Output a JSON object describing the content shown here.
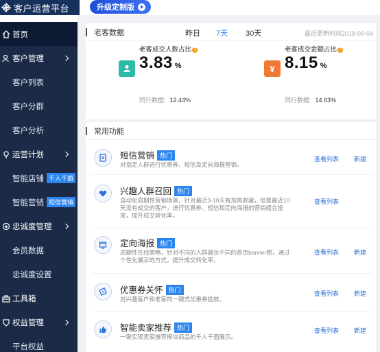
{
  "app": {
    "title": "客户运营平台",
    "upgrade_label": "升级定制版"
  },
  "sidebar": {
    "items": [
      {
        "label": "首页",
        "type": "parent",
        "icon": "home-icon",
        "active": true
      },
      {
        "label": "客户管理",
        "type": "parent",
        "icon": "users-icon"
      },
      {
        "label": "客户列表",
        "type": "child"
      },
      {
        "label": "客户分群",
        "type": "child"
      },
      {
        "label": "客户分析",
        "type": "child"
      },
      {
        "label": "运营计划",
        "type": "parent",
        "icon": "bulb-icon"
      },
      {
        "label": "智能店铺",
        "type": "child",
        "tag": "千人千面"
      },
      {
        "label": "智能营销",
        "type": "child",
        "tag": "短信营销"
      },
      {
        "label": "忠诚度管理",
        "type": "parent",
        "icon": "badge-icon"
      },
      {
        "label": "会员数据",
        "type": "child"
      },
      {
        "label": "忠诚度设置",
        "type": "child"
      },
      {
        "label": "工具箱",
        "type": "parent",
        "icon": "toolbox-icon",
        "no_chevron": true
      },
      {
        "label": "权益管理",
        "type": "parent",
        "icon": "rights-icon"
      },
      {
        "label": "平台权益",
        "type": "child"
      }
    ]
  },
  "old_customer": {
    "title": "老客数据",
    "ranges": [
      "昨日",
      "7天",
      "30天"
    ],
    "active_range": "7天",
    "updated": "最后更新时间2018-09-04",
    "metrics": [
      {
        "label": "老客成交人数占比",
        "value": "3.83",
        "unit": "%",
        "peer_label": "同行数据:",
        "peer_value": "12.44%",
        "icon_text": "♙",
        "color": "#2bbba6"
      },
      {
        "label": "老客成交金额占比",
        "value": "8.15",
        "unit": "%",
        "peer_label": "同行数据:",
        "peer_value": "14.63%",
        "icon_text": "¥",
        "color": "#f07a33"
      }
    ]
  },
  "functions": {
    "title": "常用功能",
    "hot_label": "热门",
    "items": [
      {
        "name": "短信营销",
        "desc": "对指定人群进行优惠券、短信及定向海报营销。",
        "links": [
          "查看列表",
          "新建"
        ],
        "icon": "sms-icon"
      },
      {
        "name": "兴趣人群召回",
        "desc": "自动化周期性营销场景，针对最近3-10天有加购收藏，但是最近10天没有成交的客户，进行优惠券、短信和定向海报的营销组合投放，提升成交转化率。",
        "links": [
          "查看列表"
        ],
        "icon": "heart-icon"
      },
      {
        "name": "定向海报",
        "desc": "周期性在线策略，针对不同的人群展示不同的首页banner图，通过个性化展示的方式，提升成交转化率。",
        "links": [
          "查看列表",
          "新建"
        ],
        "icon": "poster-icon"
      },
      {
        "name": "优惠券关怀",
        "desc": "对兴趣客户和老客的一键式优惠券投放。",
        "links": [
          "查看列表",
          "新建"
        ],
        "icon": "coupon-icon"
      },
      {
        "name": "智能卖家推荐",
        "desc": "一键实现卖家推荐模块商品的千人千面展示。",
        "links": [
          "查看列表",
          "新建"
        ],
        "icon": "thumb-icon"
      }
    ]
  }
}
